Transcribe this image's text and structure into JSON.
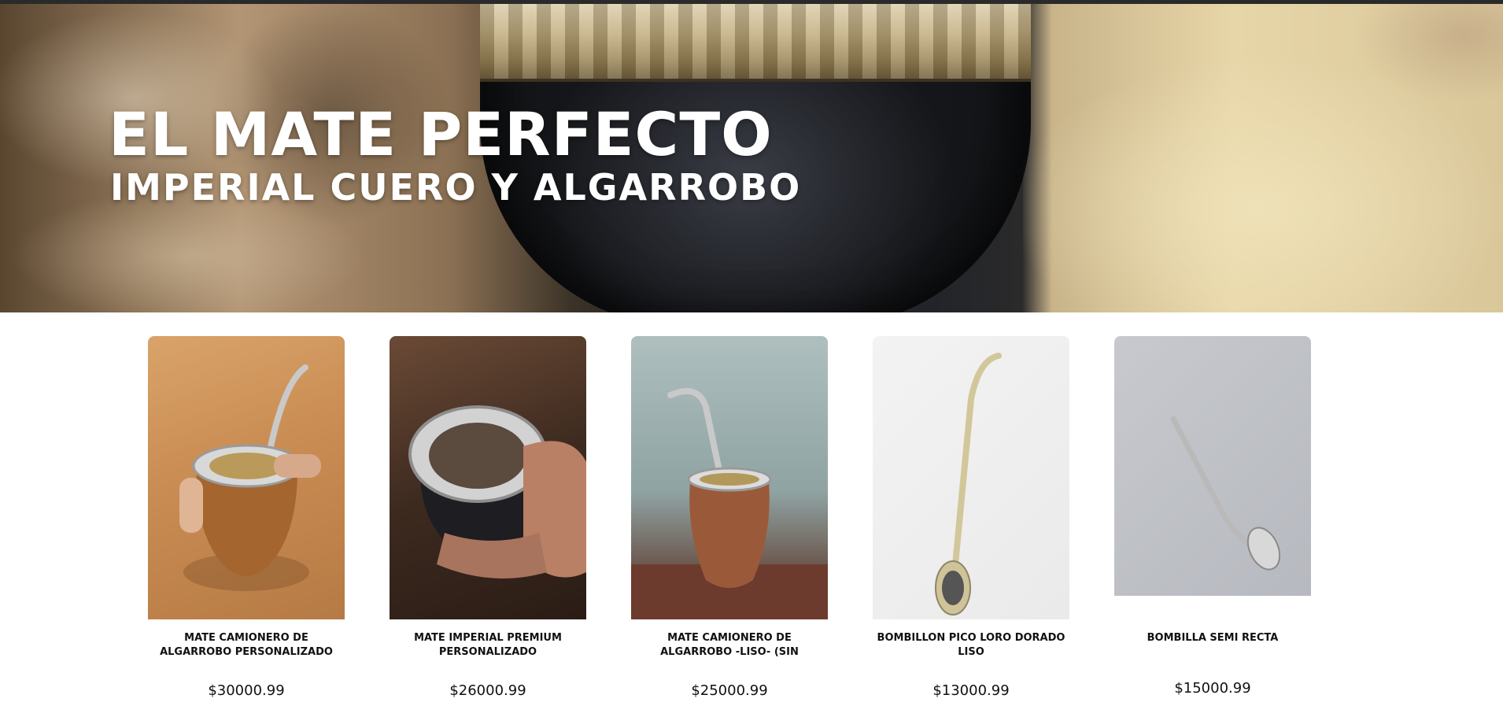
{
  "hero": {
    "title": "EL MATE PERFECTO",
    "subtitle": "IMPERIAL CUERO Y ALGARROBO"
  },
  "products": [
    {
      "name": "MATE CAMIONERO DE ALGARROBO PERSONALIZADO",
      "price": "$30000.99",
      "image": "mate-camionero-personalizado"
    },
    {
      "name": "MATE IMPERIAL PREMIUM PERSONALIZADO",
      "price": "$26000.99",
      "image": "mate-imperial-premium"
    },
    {
      "name": "MATE CAMIONERO DE ALGARROBO -LISO- (sin",
      "price": "$25000.99",
      "image": "mate-camionero-liso"
    },
    {
      "name": "BOMBILLON PICO LORO DORADO LISO",
      "price": "$13000.99",
      "image": "bombillon-pico-loro"
    },
    {
      "name": "BOMBILLA SEMI RECTA",
      "price": "$15000.99",
      "image": "bombilla-semi-recta"
    }
  ],
  "colors": {
    "hero_text": "#ffffff",
    "product_text": "#111111",
    "page_background": "#ffffff"
  }
}
